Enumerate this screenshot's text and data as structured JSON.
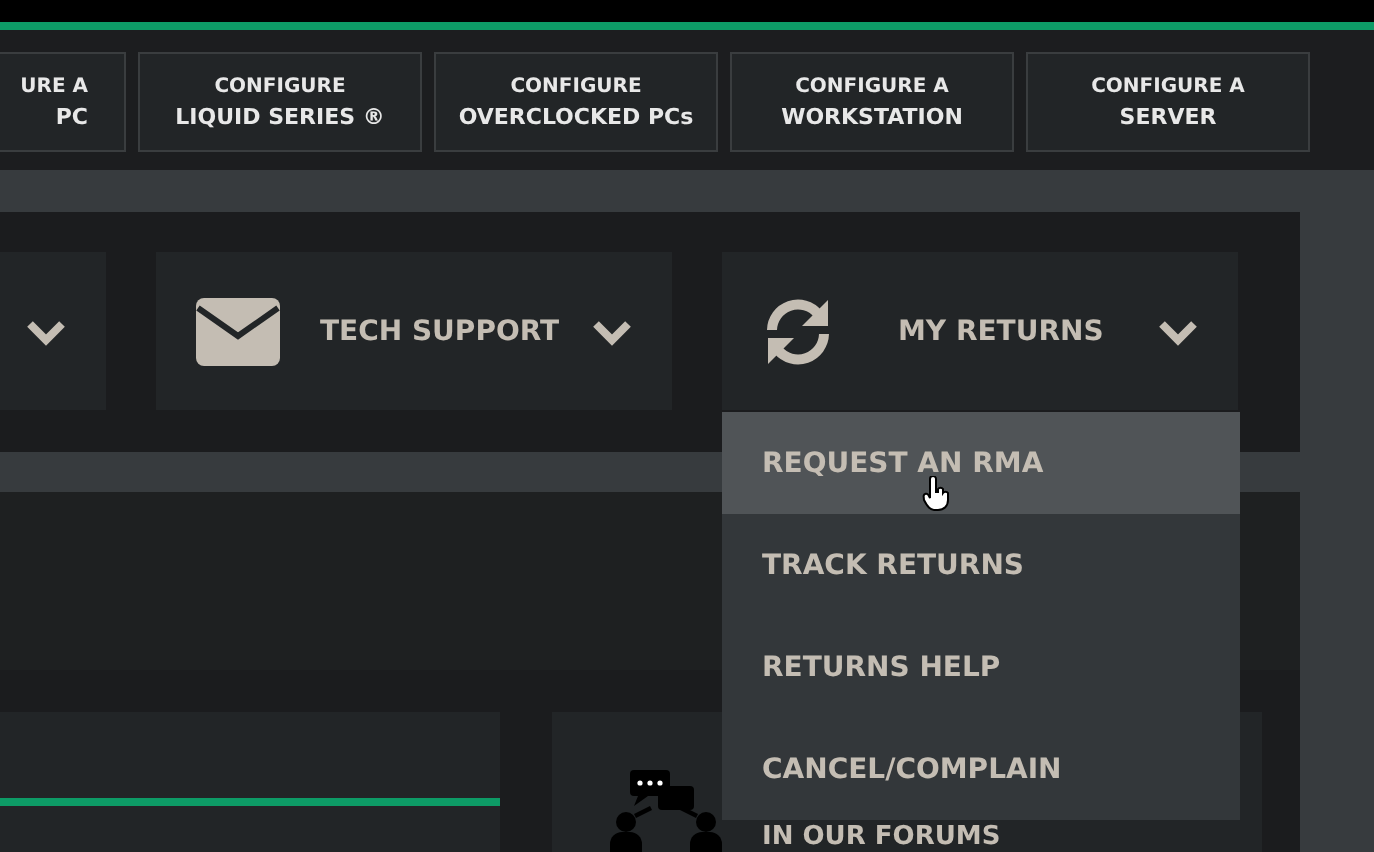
{
  "configure_links": [
    {
      "line1": "URE A",
      "line2": "PC"
    },
    {
      "line1": "CONFIGURE",
      "line2": "LIQUID SERIES ®"
    },
    {
      "line1": "CONFIGURE",
      "line2": "OVERCLOCKED PCs"
    },
    {
      "line1": "CONFIGURE A",
      "line2": "WORKSTATION"
    },
    {
      "line1": "CONFIGURE A",
      "line2": "SERVER"
    }
  ],
  "support_menu": [
    {
      "kind": "partial"
    },
    {
      "kind": "mail",
      "label": "TECH SUPPORT"
    },
    {
      "kind": "returns",
      "label": "MY RETURNS"
    }
  ],
  "returns_dropdown": [
    {
      "label": "REQUEST AN RMA",
      "selected": true
    },
    {
      "label": "TRACK RETURNS",
      "selected": false
    },
    {
      "label": "RETURNS HELP",
      "selected": false
    },
    {
      "label": "CANCEL/COMPLAIN",
      "selected": false
    }
  ],
  "forum_card": {
    "text": "IN OUR FORUMS"
  }
}
